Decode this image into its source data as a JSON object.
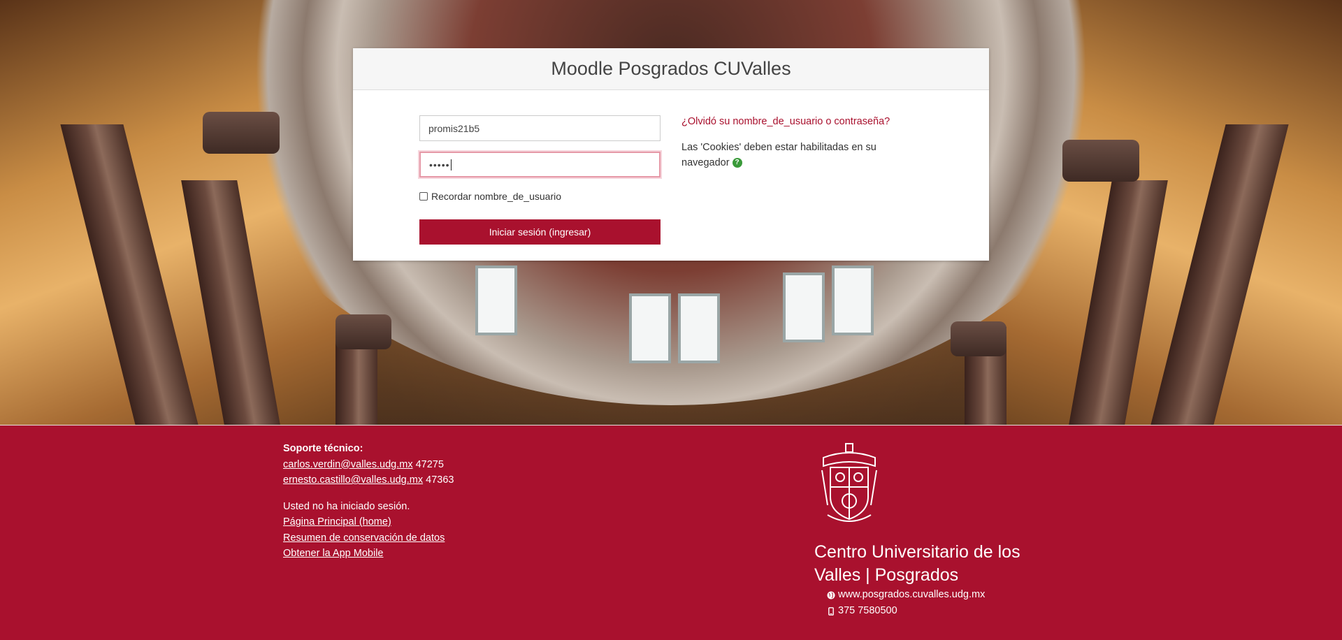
{
  "login": {
    "title": "Moodle Posgrados CUValles",
    "username_value": "promis21b5",
    "password_mask": "•••••",
    "remember_label": "Recordar nombre_de_usuario",
    "remember_checked": false,
    "submit_label": "Iniciar sesión (ingresar)",
    "forgot_link": "¿Olvidó su nombre_de_usuario o contraseña?",
    "cookies_text": "Las 'Cookies' deben estar habilitadas en su navegador",
    "help_icon": "question-circle-icon"
  },
  "footer": {
    "support_heading": "Soporte técnico:",
    "support_contacts": [
      {
        "email": "carlos.verdin@valles.udg.mx",
        "ext": "47275"
      },
      {
        "email": "ernesto.castillo@valles.udg.mx",
        "ext": "47363"
      }
    ],
    "login_status": "Usted no ha iniciado sesión.",
    "links": [
      "Página Principal (home)",
      "Resumen de conservación de datos",
      "Obtener la App Mobile"
    ],
    "center_name": "Centro Universitario de los Valles | Posgrados",
    "website": "www.posgrados.cuvalles.udg.mx",
    "phone": "375 7580500",
    "website_icon": "globe-icon",
    "phone_icon": "mobile-phone-icon"
  },
  "colors": {
    "brand": "#a9112e",
    "link": "#a9112e",
    "help_green": "#3a9a3a"
  }
}
